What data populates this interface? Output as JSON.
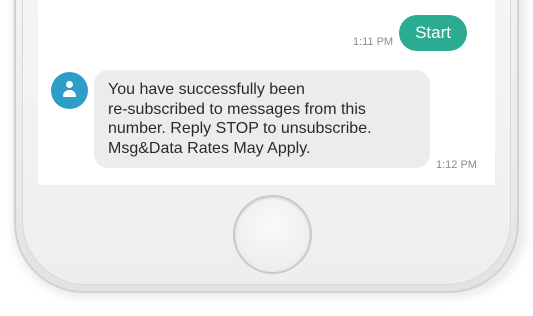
{
  "conversation": {
    "sent_message": {
      "text": "Start",
      "time": "1:11 PM",
      "bubble_color": "#2bab91"
    },
    "received_message": {
      "lines": [
        "You have successfully been",
        "re-subscribed to messages from this",
        "number. Reply STOP to unsubscribe.",
        "Msg&Data Rates May Apply."
      ],
      "time": "1:12 PM",
      "bubble_color": "#ececec",
      "avatar_icon": "person-icon",
      "avatar_color": "#2c9ec8"
    }
  },
  "device": {
    "home_button_icon": "home-button"
  }
}
